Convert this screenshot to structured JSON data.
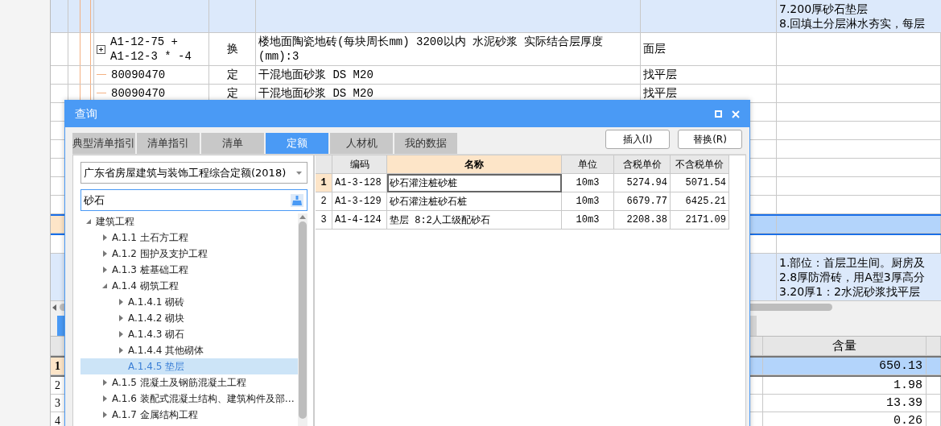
{
  "main_grid": {
    "rows": [
      {
        "kind": "item",
        "selected": false,
        "description": [
          "7.200厚砂石垫层",
          "8.回填土分层淋水夯实，每层"
        ]
      },
      {
        "kind": "quota",
        "selected": false,
        "expanded": false,
        "code_lines": [
          "A1-12-75 +",
          "A1-12-3 * -4"
        ],
        "type": "换",
        "name": "楼地面陶瓷地砖(每块周长mm) 3200以内 水泥砂浆  实际结合层厚度(mm):3",
        "feature": "面层"
      },
      {
        "kind": "quota",
        "selected": false,
        "code_lines": [
          "80090470"
        ],
        "type": "定",
        "name": "干混地面砂浆 DS M20",
        "feature": "找平层"
      },
      {
        "kind": "quota",
        "selected": false,
        "code_lines": [
          "80090470"
        ],
        "type": "定",
        "name": "干混地面砂浆 DS M20",
        "feature": "找平层"
      },
      {
        "kind": "blank",
        "selected": false
      },
      {
        "kind": "blank",
        "selected": false
      },
      {
        "kind": "blank",
        "selected": false
      },
      {
        "kind": "blank",
        "selected": false
      },
      {
        "kind": "blank",
        "selected": false
      },
      {
        "kind": "blank",
        "selected": false
      },
      {
        "kind": "blank",
        "selected": true
      },
      {
        "kind": "blank",
        "selected": false
      },
      {
        "kind": "item",
        "selected": false,
        "description": [
          "1.部位：首层卫生间。厨房及",
          "2.8厚防滑砖，用A型3厚高分",
          "3.20厚1：2水泥砂浆找平层"
        ]
      }
    ]
  },
  "bottom_grid": {
    "columns": [
      "含量"
    ],
    "rows": [
      {
        "number": "1",
        "amount": "650.13",
        "selected": true
      },
      {
        "number": "2",
        "amount": "1.98",
        "selected": false
      },
      {
        "number": "3",
        "amount": "13.39",
        "selected": false
      },
      {
        "number": "4",
        "amount": "0.26",
        "selected": false
      }
    ]
  },
  "dialog": {
    "title": "查询",
    "tabs": [
      {
        "label": "典型清单指引",
        "selected": false
      },
      {
        "label": "清单指引",
        "selected": false
      },
      {
        "label": "清单",
        "selected": false
      },
      {
        "label": "定额",
        "selected": true
      },
      {
        "label": "人材机",
        "selected": false
      },
      {
        "label": "我的数据",
        "selected": false
      }
    ],
    "buttons": [
      "插入(I)",
      "替换(R)"
    ],
    "quota_library": "广东省房屋建筑与装饰工程综合定额(2018)",
    "search": {
      "value": "砂石"
    },
    "tree": [
      {
        "label": "建筑工程",
        "expanded": true,
        "selected": false,
        "children": [
          {
            "label": "A.1.1 土石方工程",
            "expanded": false,
            "selected": false
          },
          {
            "label": "A.1.2 围护及支护工程",
            "expanded": false,
            "selected": false
          },
          {
            "label": "A.1.3 桩基础工程",
            "expanded": false,
            "selected": false
          },
          {
            "label": "A.1.4 砌筑工程",
            "expanded": true,
            "selected": false,
            "children": [
              {
                "label": "A.1.4.1 砌砖",
                "expanded": false,
                "selected": false
              },
              {
                "label": "A.1.4.2 砌块",
                "expanded": false,
                "selected": false
              },
              {
                "label": "A.1.4.3 砌石",
                "expanded": false,
                "selected": false
              },
              {
                "label": "A.1.4.4 其他砌体",
                "expanded": false,
                "selected": false
              },
              {
                "label": "A.1.4.5 垫层",
                "selected": true
              }
            ]
          },
          {
            "label": "A.1.5 混凝土及钢筋混凝土工程",
            "expanded": false,
            "selected": false
          },
          {
            "label": "A.1.6 装配式混凝土结构、建筑构件及部…",
            "expanded": false,
            "selected": false
          },
          {
            "label": "A.1.7 金属结构工程",
            "expanded": false,
            "selected": false
          }
        ]
      }
    ],
    "results": {
      "columns": [
        "编码",
        "名称",
        "单位",
        "含税单价",
        "不含税单价"
      ],
      "rows": [
        {
          "number": "1",
          "selected": true,
          "cells": [
            "A1-3-128",
            "砂石灌注桩砂桩",
            "10m3",
            "5274.94",
            "5071.54"
          ]
        },
        {
          "number": "2",
          "selected": false,
          "cells": [
            "A1-3-129",
            "砂石灌注桩砂石桩",
            "10m3",
            "6679.77",
            "6425.21"
          ]
        },
        {
          "number": "3",
          "selected": false,
          "cells": [
            "A1-4-124",
            "垫层 8:2人工级配砂石",
            "10m3",
            "2208.38",
            "2171.09"
          ]
        }
      ]
    }
  }
}
